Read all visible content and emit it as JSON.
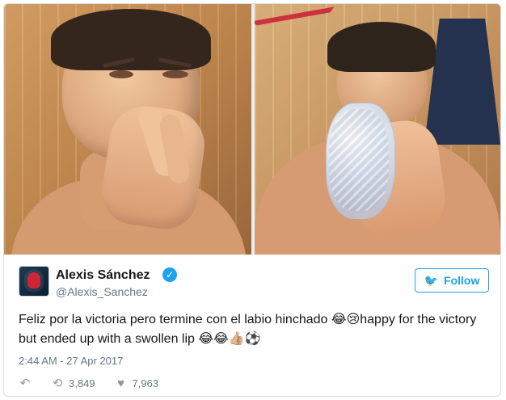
{
  "tweet": {
    "name": "Alexis Sánchez",
    "handle": "@Alexis_Sanchez",
    "text": "Feliz por la victoria pero termine con el labio hinchado 😂😢happy for the victory but ended up with a swollen lip 😂😂👍🏼⚽",
    "time": "2:44 AM - 27 Apr 2017",
    "retweets": "3,849",
    "likes": "7,963",
    "follow_label": "Follow"
  },
  "icons": {
    "verified": "verified-icon",
    "twitter": "twitter-bird-icon",
    "reply": "reply-icon",
    "retweet": "retweet-icon",
    "like": "heart-icon"
  },
  "colors": {
    "accent": "#1da1f2",
    "text": "#14171a",
    "muted": "#657786",
    "border": "#d8dde2"
  }
}
